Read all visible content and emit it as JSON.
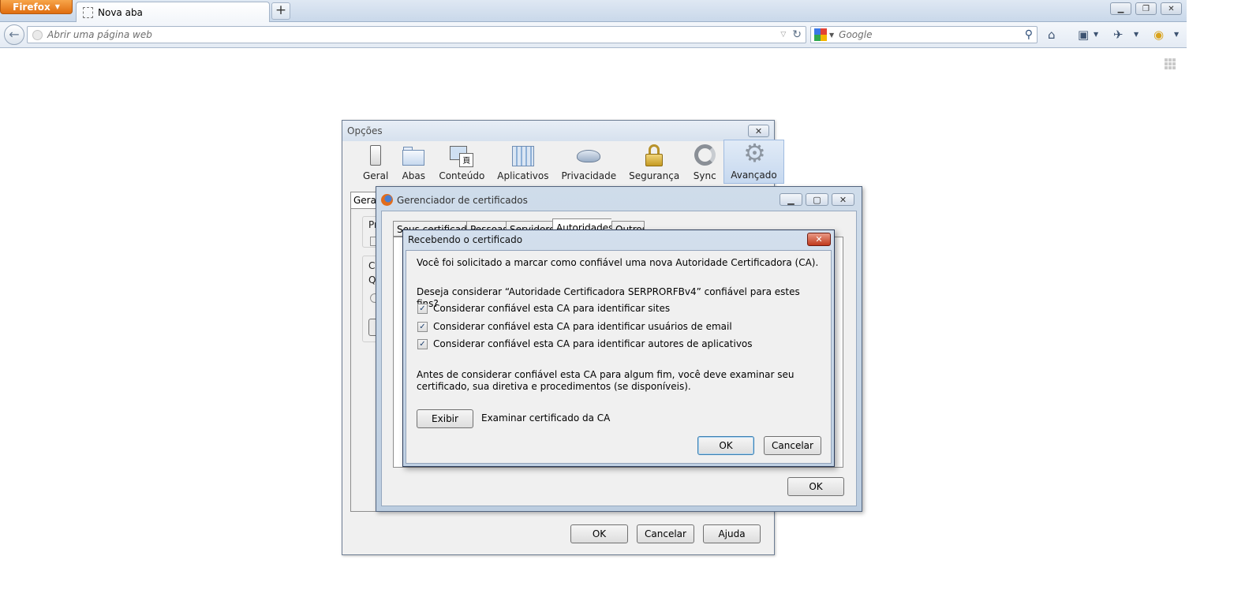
{
  "browser": {
    "menu_button": "Firefox",
    "tab_title": "Nova aba",
    "new_tab_symbol": "+",
    "url_placeholder": "Abrir uma página web",
    "search_placeholder": "Google",
    "accent": "#e06d0f"
  },
  "options_window": {
    "title": "Opções",
    "panes": [
      {
        "label": "Geral",
        "icon": "switch-icon"
      },
      {
        "label": "Abas",
        "icon": "tabs-icon"
      },
      {
        "label": "Conteúdo",
        "icon": "content-icon"
      },
      {
        "label": "Aplicativos",
        "icon": "applications-icon"
      },
      {
        "label": "Privacidade",
        "icon": "mask-icon"
      },
      {
        "label": "Segurança",
        "icon": "padlock-icon"
      },
      {
        "label": "Sync",
        "icon": "sync-icon"
      },
      {
        "label": "Avançado",
        "icon": "gear-icon"
      }
    ],
    "active_pane": "Avançado",
    "visible_tab": "Geral",
    "fragments": [
      "Pr",
      "Co",
      "Q"
    ],
    "buttons": {
      "ok": "OK",
      "cancel": "Cancelar",
      "help": "Ajuda"
    }
  },
  "cert_manager": {
    "title": "Gerenciador de certificados",
    "tabs": [
      "Seus certificados",
      "Pessoas",
      "Servidores",
      "Autoridades",
      "Outros"
    ],
    "active_tab": "Autoridades",
    "ok_label": "OK"
  },
  "download_dialog": {
    "title": "Recebendo o certificado",
    "intro": "Você foi solicitado a marcar como confiável uma nova Autoridade Certificadora (CA).",
    "question": "Deseja considerar “Autoridade Certificadora SERPRORFBv4” confiável para estes fins?",
    "options": [
      {
        "label": "Considerar confiável esta CA para identificar sites",
        "checked": true
      },
      {
        "label": "Considerar confiável esta CA para identificar usuários de email",
        "checked": true
      },
      {
        "label": "Considerar confiável esta CA para identificar autores de aplicativos",
        "checked": true
      }
    ],
    "warning": "Antes de considerar confiável esta CA para algum fim, você deve examinar seu certificado, sua diretiva e procedimentos (se disponíveis).",
    "view_button": "Exibir",
    "view_description": "Examinar certificado da CA",
    "ok_label": "OK",
    "cancel_label": "Cancelar",
    "check_mark": "✓"
  }
}
